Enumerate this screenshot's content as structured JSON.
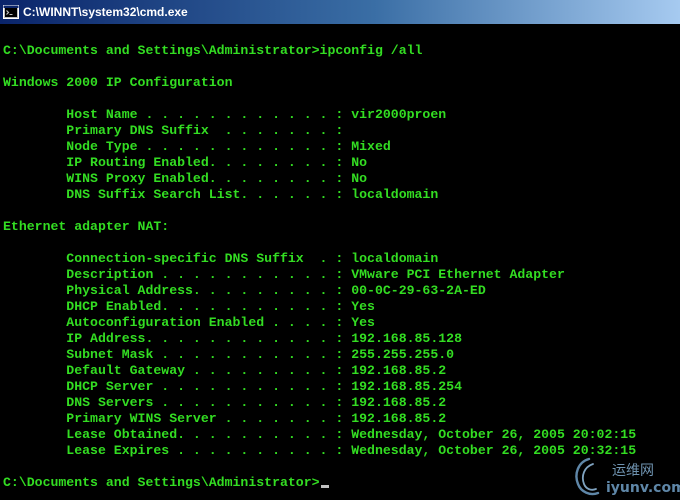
{
  "window": {
    "title": "C:\\WINNT\\system32\\cmd.exe"
  },
  "console": {
    "lines": [
      "",
      "C:\\Documents and Settings\\Administrator>ipconfig /all",
      "",
      "Windows 2000 IP Configuration",
      "",
      "        Host Name . . . . . . . . . . . . : vir2000proen",
      "        Primary DNS Suffix  . . . . . . . :",
      "        Node Type . . . . . . . . . . . . : Mixed",
      "        IP Routing Enabled. . . . . . . . : No",
      "        WINS Proxy Enabled. . . . . . . . : No",
      "        DNS Suffix Search List. . . . . . : localdomain",
      "",
      "Ethernet adapter NAT:",
      "",
      "        Connection-specific DNS Suffix  . : localdomain",
      "        Description . . . . . . . . . . . : VMware PCI Ethernet Adapter",
      "        Physical Address. . . . . . . . . : 00-0C-29-63-2A-ED",
      "        DHCP Enabled. . . . . . . . . . . : Yes",
      "        Autoconfiguration Enabled . . . . : Yes",
      "        IP Address. . . . . . . . . . . . : 192.168.85.128",
      "        Subnet Mask . . . . . . . . . . . : 255.255.255.0",
      "        Default Gateway . . . . . . . . . : 192.168.85.2",
      "        DHCP Server . . . . . . . . . . . : 192.168.85.254",
      "        DNS Servers . . . . . . . . . . . : 192.168.85.2",
      "        Primary WINS Server . . . . . . . : 192.168.85.2",
      "        Lease Obtained. . . . . . . . . . : Wednesday, October 26, 2005 20:02:15",
      "        Lease Expires . . . . . . . . . . : Wednesday, October 26, 2005 20:32:15",
      "",
      "C:\\Documents and Settings\\Administrator>"
    ]
  },
  "watermark": {
    "cn_text": "运维网",
    "en_text": "iyunv.com"
  },
  "colors": {
    "console_background": "#000000",
    "console_text": "#33dd22",
    "titlebar_start": "#0a246a",
    "titlebar_end": "#a6caf0"
  }
}
